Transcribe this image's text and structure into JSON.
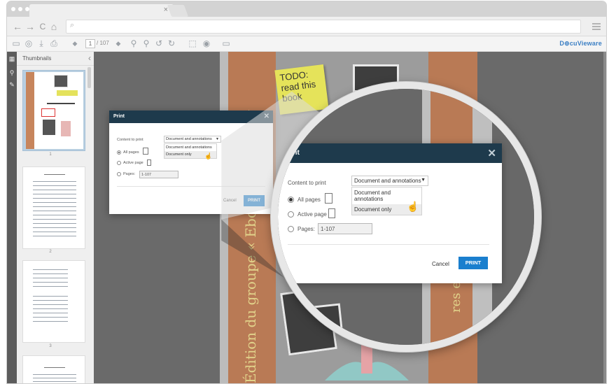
{
  "browser": {
    "tab_close": "×",
    "nav": {
      "back": "←",
      "forward": "→",
      "reload": "C",
      "home": "⌂"
    },
    "search_glyph": "⌕"
  },
  "toolbar": {
    "page_current": "1",
    "page_total": "/ 107",
    "brand": "D⊚cuVieware",
    "icons": [
      "open-icon",
      "save-icon",
      "download-icon",
      "print-icon",
      "first-page-icon",
      "zoom-out-icon",
      "zoom-in-icon",
      "rotate-left-icon",
      "rotate-right-icon",
      "select-icon",
      "eye-icon",
      "fullscreen-icon"
    ]
  },
  "sidebar": {
    "title": "Thumbnails",
    "collapse": "‹",
    "thumbnails": [
      {
        "num": "1",
        "selected": true
      },
      {
        "num": "2",
        "selected": false
      },
      {
        "num": "3",
        "selected": false
      },
      {
        "num": "",
        "selected": false
      }
    ]
  },
  "document": {
    "sticky_note": "TODO:\nread this\nbook",
    "spine_left": "Édition du groupe « Ebooks libres et g",
    "spine_right": "res et g"
  },
  "print_dialog": {
    "title": "Print",
    "close": "✕",
    "content_label": "Content to print",
    "select_value": "Document and annotations",
    "select_arrow": "▼",
    "options": [
      "Document and annotations",
      "Document only"
    ],
    "radio_all": "All pages",
    "radio_active": "Active page",
    "radio_pages": "Pages:",
    "pages_value": "1-107",
    "cancel": "Cancel",
    "print": "PRINT"
  }
}
